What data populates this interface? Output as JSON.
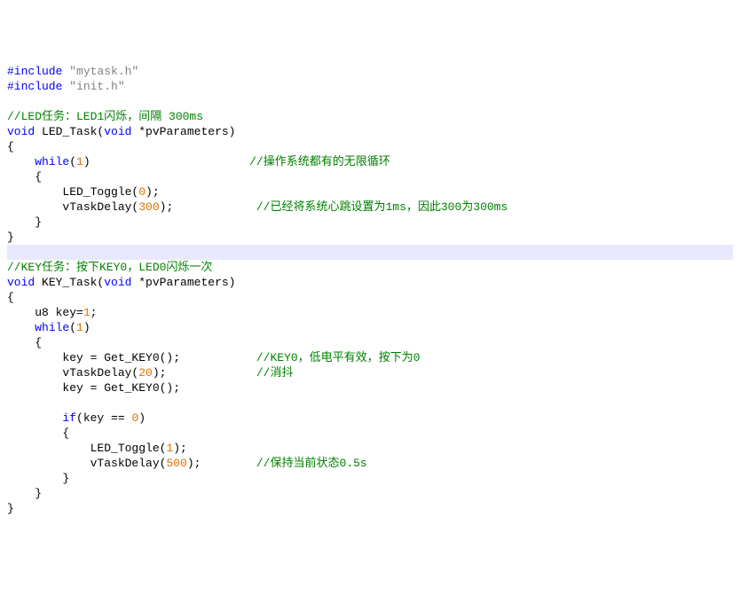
{
  "code": {
    "lines": [
      {
        "segments": [
          {
            "t": "#include ",
            "c": "kw"
          },
          {
            "t": "\"mytask.h\"",
            "c": "str"
          }
        ]
      },
      {
        "segments": [
          {
            "t": "#include ",
            "c": "kw"
          },
          {
            "t": "\"init.h\"",
            "c": "str"
          }
        ]
      },
      {
        "segments": []
      },
      {
        "segments": [
          {
            "t": "//LED任务：LED1闪烁，间隔 300ms",
            "c": "cmt"
          }
        ]
      },
      {
        "segments": [
          {
            "t": "void",
            "c": "kw"
          },
          {
            "t": " LED_Task(",
            "c": "txt"
          },
          {
            "t": "void",
            "c": "kw"
          },
          {
            "t": " *pvParameters)",
            "c": "txt"
          }
        ]
      },
      {
        "segments": [
          {
            "t": "{",
            "c": "txt"
          }
        ]
      },
      {
        "segments": [
          {
            "t": "    ",
            "c": "txt"
          },
          {
            "t": "while",
            "c": "kw"
          },
          {
            "t": "(",
            "c": "txt"
          },
          {
            "t": "1",
            "c": "num"
          },
          {
            "t": ")                       ",
            "c": "txt"
          },
          {
            "t": "//操作系统都有的无限循环",
            "c": "cmt"
          }
        ]
      },
      {
        "segments": [
          {
            "t": "    {",
            "c": "txt"
          }
        ]
      },
      {
        "segments": [
          {
            "t": "        LED_Toggle(",
            "c": "txt"
          },
          {
            "t": "0",
            "c": "num"
          },
          {
            "t": ");",
            "c": "txt"
          }
        ]
      },
      {
        "segments": [
          {
            "t": "        vTaskDelay(",
            "c": "txt"
          },
          {
            "t": "300",
            "c": "num"
          },
          {
            "t": ");            ",
            "c": "txt"
          },
          {
            "t": "//已经将系统心跳设置为1ms，因此300为300ms",
            "c": "cmt"
          }
        ]
      },
      {
        "segments": [
          {
            "t": "    }",
            "c": "txt"
          }
        ]
      },
      {
        "segments": [
          {
            "t": "}",
            "c": "txt"
          }
        ]
      },
      {
        "segments": [],
        "cursor": true
      },
      {
        "segments": [
          {
            "t": "//KEY任务：按下KEY0，LED0闪烁一次",
            "c": "cmt"
          }
        ]
      },
      {
        "segments": [
          {
            "t": "void",
            "c": "kw"
          },
          {
            "t": " KEY_Task(",
            "c": "txt"
          },
          {
            "t": "void",
            "c": "kw"
          },
          {
            "t": " *pvParameters)",
            "c": "txt"
          }
        ]
      },
      {
        "segments": [
          {
            "t": "{",
            "c": "txt"
          }
        ]
      },
      {
        "segments": [
          {
            "t": "    u8 key=",
            "c": "txt"
          },
          {
            "t": "1",
            "c": "num"
          },
          {
            "t": ";",
            "c": "txt"
          }
        ]
      },
      {
        "segments": [
          {
            "t": "    ",
            "c": "txt"
          },
          {
            "t": "while",
            "c": "kw"
          },
          {
            "t": "(",
            "c": "txt"
          },
          {
            "t": "1",
            "c": "num"
          },
          {
            "t": ")",
            "c": "txt"
          }
        ]
      },
      {
        "segments": [
          {
            "t": "    {",
            "c": "txt"
          }
        ]
      },
      {
        "segments": [
          {
            "t": "        key = Get_KEY0();           ",
            "c": "txt"
          },
          {
            "t": "//KEY0，低电平有效，按下为0",
            "c": "cmt"
          }
        ]
      },
      {
        "segments": [
          {
            "t": "        vTaskDelay(",
            "c": "txt"
          },
          {
            "t": "20",
            "c": "num"
          },
          {
            "t": ");             ",
            "c": "txt"
          },
          {
            "t": "//消抖",
            "c": "cmt"
          }
        ]
      },
      {
        "segments": [
          {
            "t": "        key = Get_KEY0();",
            "c": "txt"
          }
        ]
      },
      {
        "segments": []
      },
      {
        "segments": [
          {
            "t": "        ",
            "c": "txt"
          },
          {
            "t": "if",
            "c": "kw"
          },
          {
            "t": "(key == ",
            "c": "txt"
          },
          {
            "t": "0",
            "c": "num"
          },
          {
            "t": ")",
            "c": "txt"
          }
        ]
      },
      {
        "segments": [
          {
            "t": "        {",
            "c": "txt"
          }
        ]
      },
      {
        "segments": [
          {
            "t": "            LED_Toggle(",
            "c": "txt"
          },
          {
            "t": "1",
            "c": "num"
          },
          {
            "t": ");",
            "c": "txt"
          }
        ]
      },
      {
        "segments": [
          {
            "t": "            vTaskDelay(",
            "c": "txt"
          },
          {
            "t": "500",
            "c": "num"
          },
          {
            "t": ");        ",
            "c": "txt"
          },
          {
            "t": "//保持当前状态0.5s",
            "c": "cmt"
          }
        ]
      },
      {
        "segments": [
          {
            "t": "        }",
            "c": "txt"
          }
        ]
      },
      {
        "segments": [
          {
            "t": "    }",
            "c": "txt"
          }
        ]
      },
      {
        "segments": [
          {
            "t": "}",
            "c": "txt"
          }
        ]
      }
    ]
  }
}
